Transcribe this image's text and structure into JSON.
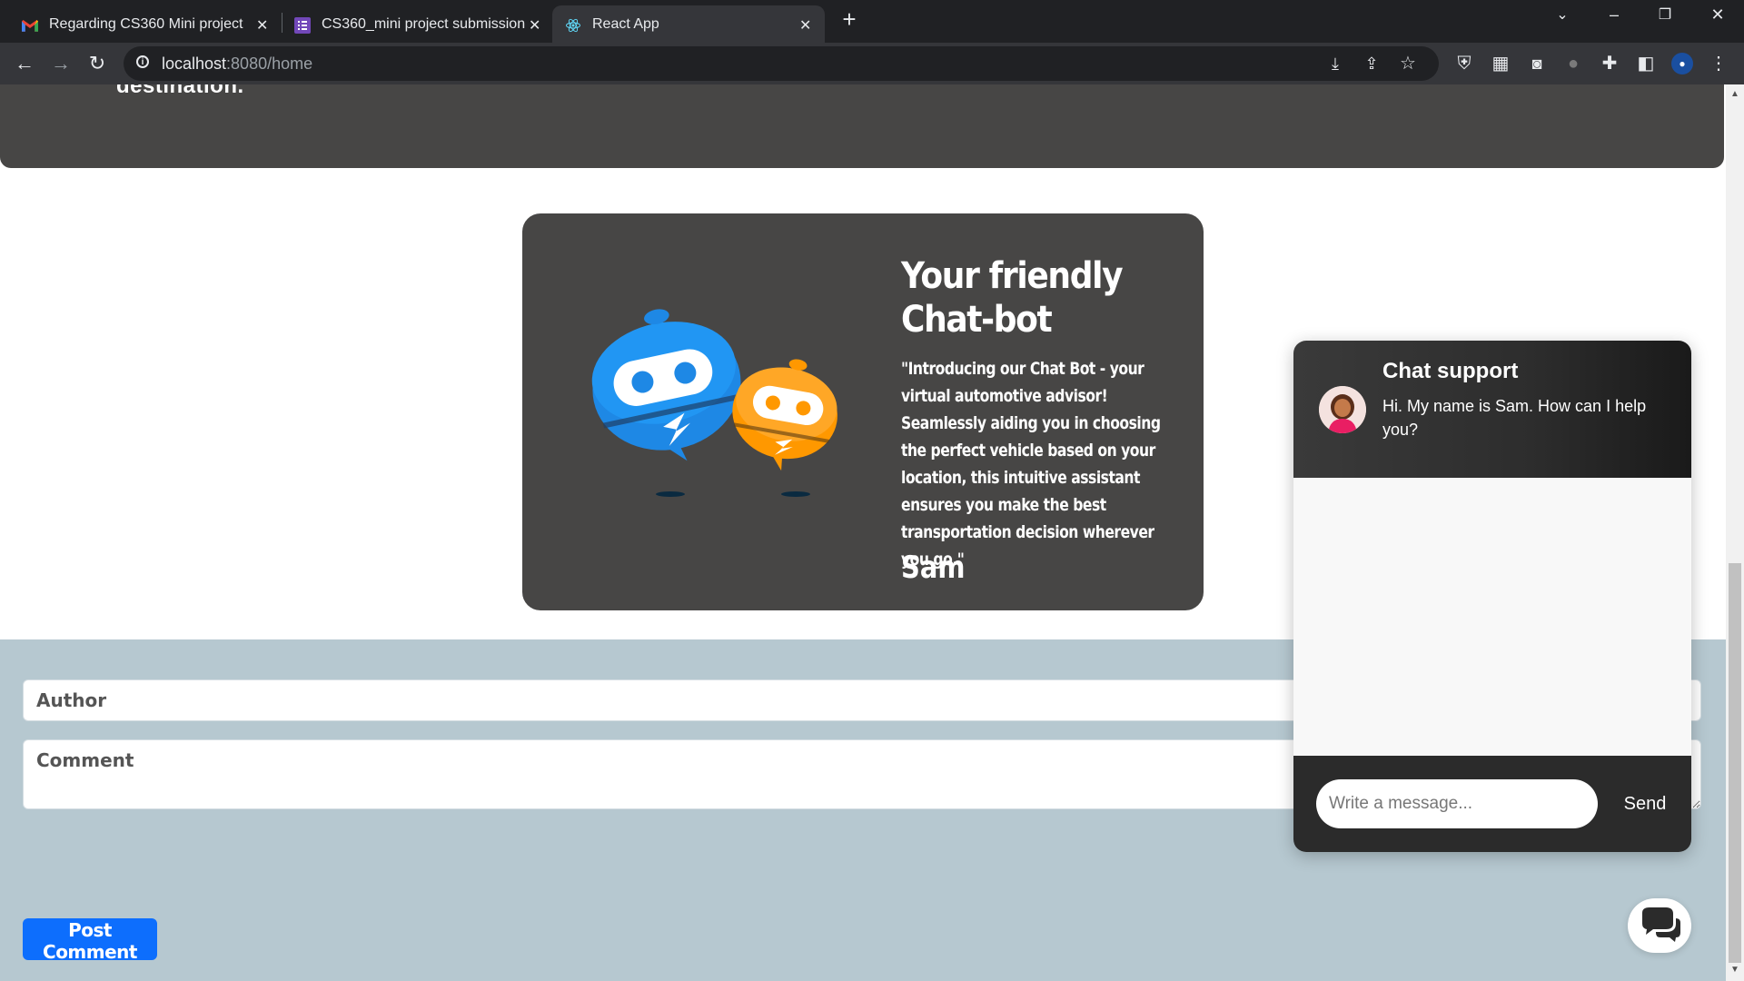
{
  "browser": {
    "tabs": [
      {
        "title": "Regarding CS360 Mini project - ",
        "favicon": "gmail-icon",
        "active": false
      },
      {
        "title": "CS360_mini project submission",
        "favicon": "forms-icon",
        "active": false
      },
      {
        "title": "React App",
        "favicon": "react-icon",
        "active": true
      }
    ],
    "close_glyph": "✕",
    "new_tab_glyph": "+",
    "url_host": "localhost",
    "url_path": ":8080/home"
  },
  "hero": {
    "cut_text": "destination."
  },
  "bot_card": {
    "heading": "Your friendly Chat-bot",
    "description": "\"Introducing our Chat Bot - your virtual automotive advisor! Seamlessly aiding you in choosing the perfect vehicle based on your location, this intuitive assistant ensures you make the best transportation decision wherever you go.\"",
    "name": "Sam"
  },
  "comments": {
    "author_placeholder": "Author",
    "comment_placeholder": "Comment",
    "post_label": "Post Comment",
    "post_color": "#0d6efd"
  },
  "chat": {
    "title": "Chat support",
    "greeting": "Hi. My name is Sam. How can I help you?",
    "input_placeholder": "Write a message...",
    "send_label": "Send",
    "launcher_icon": "chat-bubbles-icon"
  },
  "colors": {
    "card_bg": "#474645",
    "comments_bg": "#b6c8d0",
    "chrome_bg": "#202124"
  }
}
